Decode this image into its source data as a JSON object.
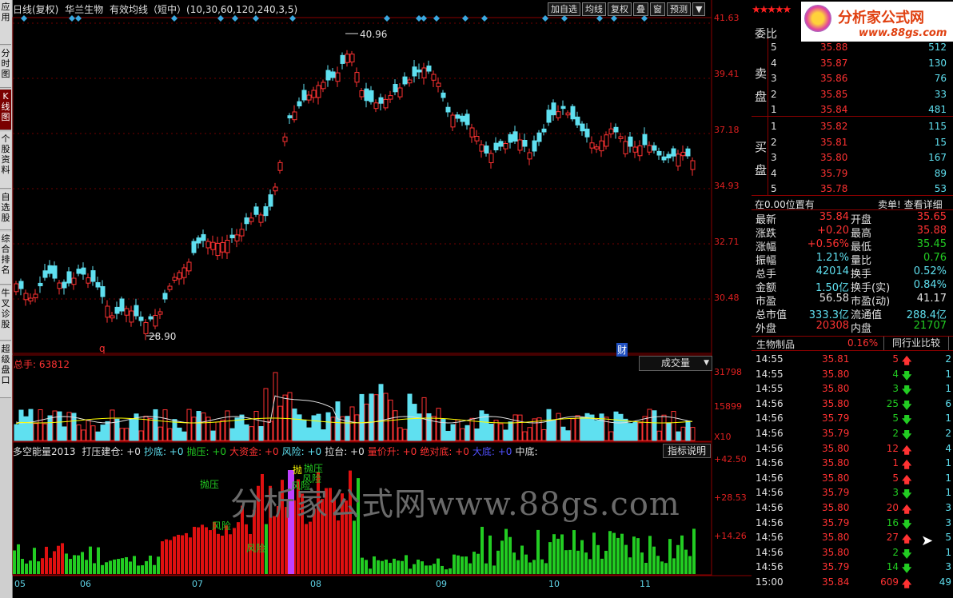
{
  "left_tabs": [
    "应用",
    "分时图",
    "K线图",
    "个股资料",
    "自选股",
    "综合排名",
    "牛叉诊股",
    "超级盘口"
  ],
  "header": {
    "period": "日线(复权)",
    "stock": "华兰生物",
    "indicator": "有效均线（短中）(10,30,60,120,240,3,5)"
  },
  "toolbar": [
    "加自选",
    "均线",
    "复权",
    "叠",
    "窗",
    "预测"
  ],
  "price_axis": [
    "41.63",
    "39.41",
    "37.18",
    "34.93",
    "32.71",
    "30.48"
  ],
  "high_label": "40.96",
  "low_label": "28.90",
  "marker_q": "q",
  "marker_cai": "财",
  "volume": {
    "label": "总手: 63812",
    "dropdown": "成交量",
    "axis": [
      "31798",
      "15899",
      "X10"
    ]
  },
  "indicator": {
    "name": "多空能量2013",
    "items": [
      {
        "t": "打压建仓: +0",
        "c": "#e0e0e0"
      },
      {
        "t": "抄底: +0",
        "c": "#5fe0f0"
      },
      {
        "t": "抛压: +0",
        "c": "#22cc22"
      },
      {
        "t": "大资金: +0",
        "c": "#ff3232"
      },
      {
        "t": "风险: +0",
        "c": "#5fe0f0"
      },
      {
        "t": "拉台: +0",
        "c": "#e0e0e0"
      },
      {
        "t": "量价升: +0",
        "c": "#ff3232"
      },
      {
        "t": "绝对底: +0",
        "c": "#ff3232"
      },
      {
        "t": "大底: +0",
        "c": "#5050ff"
      },
      {
        "t": "中底:",
        "c": "#e0e0e0"
      }
    ],
    "button": "指标说明",
    "axis": [
      "+42.50",
      "+28.53",
      "+14.26"
    ],
    "annotations": [
      "抛压",
      "风险",
      "风险",
      "抛压",
      "风险",
      "风险",
      "抛"
    ]
  },
  "watermark": "分析家公式网www.88gs.com",
  "x_axis": [
    "05",
    "06",
    "07",
    "08",
    "09",
    "10",
    "11"
  ],
  "brand": {
    "name": "分析家公式网",
    "url": "www.88gs.com",
    "stars": "★★★★★"
  },
  "order_book": {
    "title": "委比",
    "sell_label": "卖盘",
    "buy_label": "买盘",
    "asks": [
      {
        "lvl": "5",
        "p": "35.88",
        "v": "512"
      },
      {
        "lvl": "4",
        "p": "35.87",
        "v": "130"
      },
      {
        "lvl": "3",
        "p": "35.86",
        "v": "76"
      },
      {
        "lvl": "2",
        "p": "35.85",
        "v": "33"
      },
      {
        "lvl": "1",
        "p": "35.84",
        "v": "481"
      }
    ],
    "bids": [
      {
        "lvl": "1",
        "p": "35.82",
        "v": "115"
      },
      {
        "lvl": "2",
        "p": "35.81",
        "v": "15"
      },
      {
        "lvl": "3",
        "p": "35.80",
        "v": "167"
      },
      {
        "lvl": "4",
        "p": "35.79",
        "v": "89"
      },
      {
        "lvl": "5",
        "p": "35.78",
        "v": "53"
      }
    ]
  },
  "notice": {
    "left": "在0.00位置有",
    "right": "卖单! 查看详细"
  },
  "quote": [
    [
      "最新",
      "35.84",
      "开盘",
      "35.65"
    ],
    [
      "涨跌",
      "+0.20",
      "最高",
      "35.88"
    ],
    [
      "涨幅",
      "+0.56%",
      "最低",
      "35.45"
    ],
    [
      "振幅",
      "1.21%",
      "量比",
      "0.76"
    ],
    [
      "总手",
      "42014",
      "换手",
      "0.52%"
    ],
    [
      "金额",
      "1.50亿",
      "换手(实)",
      "0.84%"
    ],
    [
      "市盈",
      "56.58",
      "市盈(动)",
      "41.17"
    ],
    [
      "总市值",
      "333.3亿",
      "流通值",
      "288.4亿"
    ],
    [
      "外盘",
      "20308",
      "内盘",
      "21707"
    ]
  ],
  "industry": {
    "name": "生物制品",
    "pct": "0.16%",
    "button": "同行业比较"
  },
  "ticks": [
    [
      "14:55",
      "35.81",
      "5",
      "up",
      "2"
    ],
    [
      "14:55",
      "35.80",
      "4",
      "down",
      "1"
    ],
    [
      "14:55",
      "35.80",
      "3",
      "down",
      "1"
    ],
    [
      "14:56",
      "35.80",
      "25",
      "down",
      "6"
    ],
    [
      "14:56",
      "35.79",
      "5",
      "down",
      "1"
    ],
    [
      "14:56",
      "35.79",
      "2",
      "down",
      "2"
    ],
    [
      "14:56",
      "35.80",
      "12",
      "up",
      "4"
    ],
    [
      "14:56",
      "35.80",
      "1",
      "up",
      "1"
    ],
    [
      "14:56",
      "35.80",
      "5",
      "up",
      "1"
    ],
    [
      "14:56",
      "35.79",
      "3",
      "down",
      "1"
    ],
    [
      "14:56",
      "35.80",
      "20",
      "up",
      "3"
    ],
    [
      "14:56",
      "35.79",
      "16",
      "down",
      "3"
    ],
    [
      "14:56",
      "35.80",
      "27",
      "up",
      "5"
    ],
    [
      "14:56",
      "35.80",
      "2",
      "down",
      "1"
    ],
    [
      "14:56",
      "35.79",
      "14",
      "down",
      "3"
    ],
    [
      "15:00",
      "35.84",
      "609",
      "up",
      "49"
    ]
  ]
}
